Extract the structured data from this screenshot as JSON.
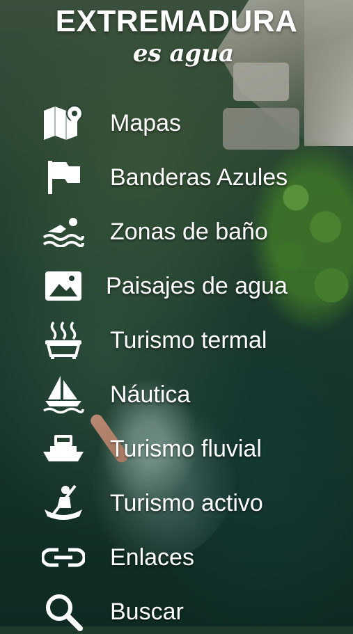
{
  "header": {
    "title": "EXTREMADURA",
    "subtitle": "es agua"
  },
  "menu": {
    "items": [
      {
        "label": "Mapas",
        "icon": "map-icon"
      },
      {
        "label": "Banderas Azules",
        "icon": "flag-icon"
      },
      {
        "label": "Zonas de baño",
        "icon": "swimmer-icon"
      },
      {
        "label": "Paisajes de agua",
        "icon": "landscape-image-icon"
      },
      {
        "label": "Turismo termal",
        "icon": "hot-tub-icon"
      },
      {
        "label": "Náutica",
        "icon": "sailboat-icon"
      },
      {
        "label": "Turismo fluvial",
        "icon": "ferry-icon"
      },
      {
        "label": "Turismo activo",
        "icon": "kayak-icon"
      },
      {
        "label": "Enlaces",
        "icon": "link-icon"
      },
      {
        "label": "Buscar",
        "icon": "search-icon"
      }
    ]
  }
}
